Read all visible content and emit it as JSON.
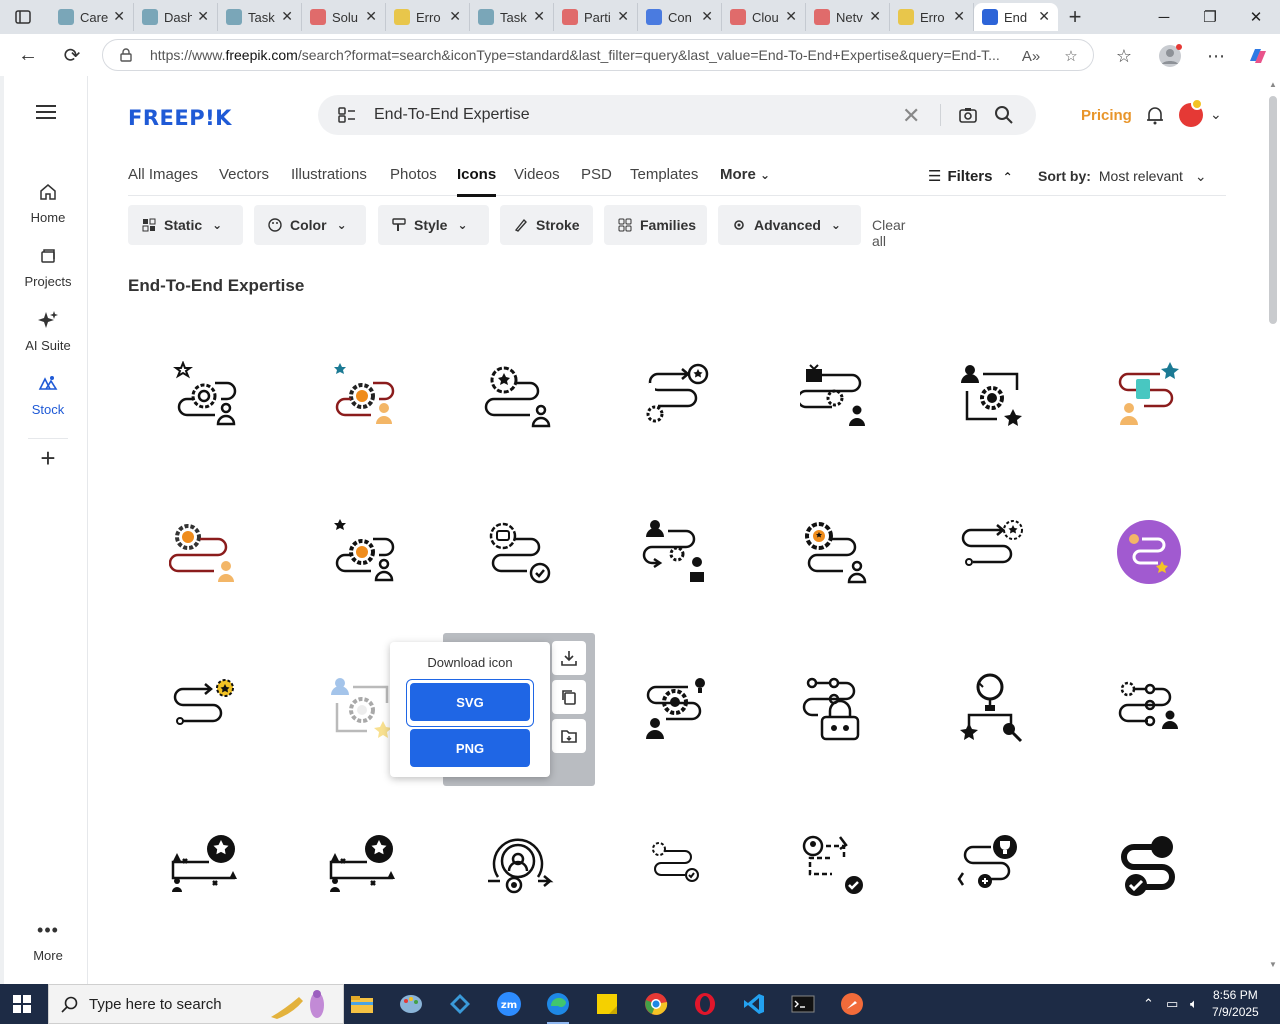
{
  "browser": {
    "tabs": [
      {
        "title": "Care",
        "color": "#7aa6b8"
      },
      {
        "title": "Dash",
        "color": "#7aa6b8"
      },
      {
        "title": "Task",
        "color": "#7aa6b8"
      },
      {
        "title": "Solu",
        "color": "#e06b6b"
      },
      {
        "title": "Erro",
        "color": "#e8c64b"
      },
      {
        "title": "Task",
        "color": "#7aa6b8"
      },
      {
        "title": "Parti",
        "color": "#e06b6b"
      },
      {
        "title": "Con",
        "color": "#4a7be0"
      },
      {
        "title": "Clou",
        "color": "#e06b6b"
      },
      {
        "title": "Netv",
        "color": "#e06b6b"
      },
      {
        "title": "Erro",
        "color": "#e8c64b"
      },
      {
        "title": "End",
        "color": "#2d64d8"
      }
    ],
    "url_prefix": "https://www.",
    "url_domain": "freepik.com",
    "url_rest": "/search?format=search&iconType=standard&last_filter=query&last_value=End-To-End+Expertise&query=End-T..."
  },
  "sidebar": {
    "items": [
      {
        "label": "Home"
      },
      {
        "label": "Projects"
      },
      {
        "label": "AI Suite"
      },
      {
        "label": "Stock"
      },
      {
        "label": "More"
      }
    ]
  },
  "header": {
    "logo": "FREEP!K",
    "search_value": "End-To-End Expertise",
    "pricing": "Pricing"
  },
  "type_tabs": [
    {
      "label": "All Images"
    },
    {
      "label": "Vectors"
    },
    {
      "label": "Illustrations"
    },
    {
      "label": "Photos"
    },
    {
      "label": "Icons"
    },
    {
      "label": "Videos"
    },
    {
      "label": "PSD"
    },
    {
      "label": "Templates"
    },
    {
      "label": "More"
    }
  ],
  "filters_label": "Filters",
  "sort": {
    "label": "Sort by:",
    "value": "Most relevant"
  },
  "chips": [
    {
      "label": "Static"
    },
    {
      "label": "Color"
    },
    {
      "label": "Style"
    },
    {
      "label": "Stroke"
    },
    {
      "label": "Families"
    },
    {
      "label": "Advanced"
    }
  ],
  "clear_all": "Clear all",
  "results_title": "End-To-End Expertise",
  "popup": {
    "title": "Download icon",
    "svg": "SVG",
    "png": "PNG"
  },
  "taskbar": {
    "search_placeholder": "Type here to search",
    "time": "8:56 PM",
    "date": "7/9/2025"
  },
  "colors": {
    "brand": "#1f5ad6",
    "pricing": "#e8952a",
    "primary_button": "#1f66e5"
  }
}
